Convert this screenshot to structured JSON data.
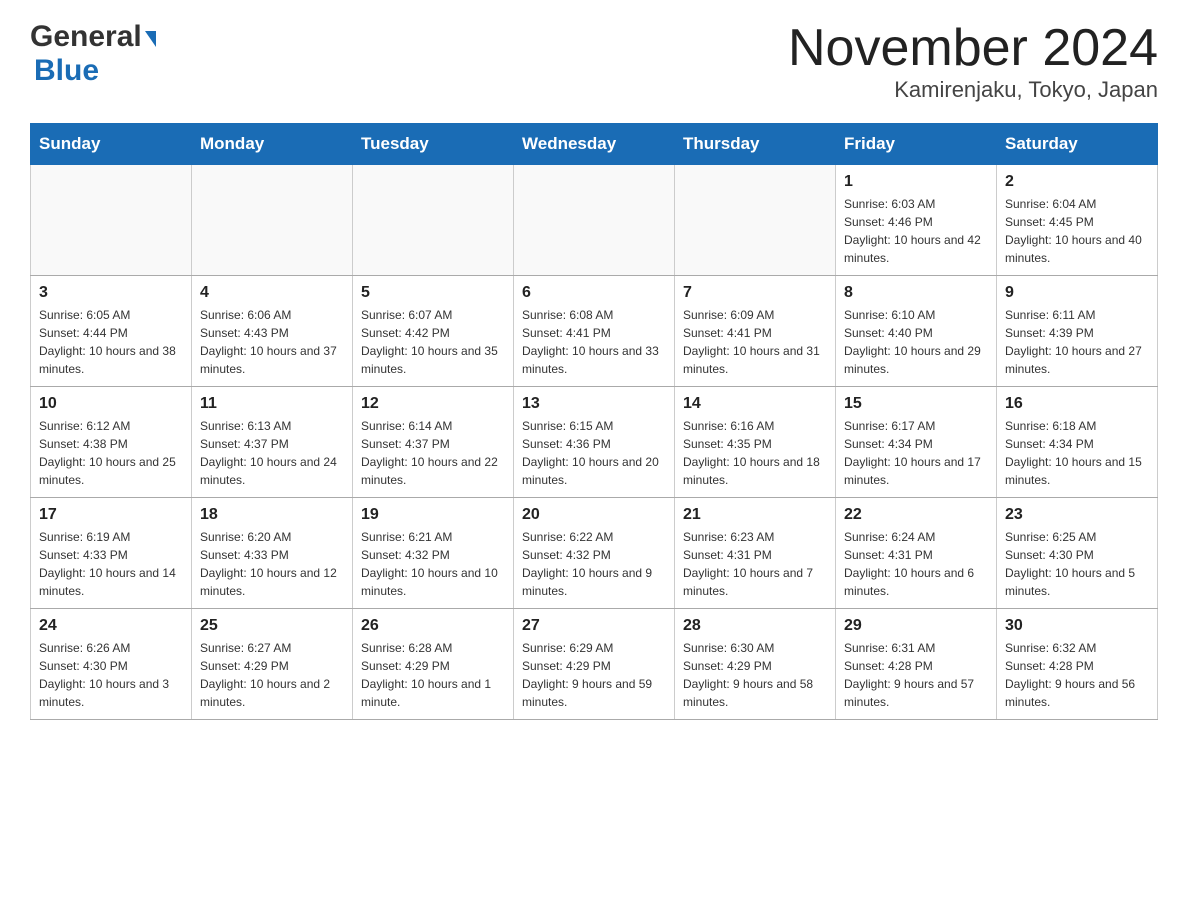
{
  "header": {
    "logo_general": "General",
    "logo_blue": "Blue",
    "month_title": "November 2024",
    "location": "Kamirenjaku, Tokyo, Japan"
  },
  "weekdays": [
    "Sunday",
    "Monday",
    "Tuesday",
    "Wednesday",
    "Thursday",
    "Friday",
    "Saturday"
  ],
  "weeks": [
    [
      {
        "day": "",
        "sunrise": "",
        "sunset": "",
        "daylight": ""
      },
      {
        "day": "",
        "sunrise": "",
        "sunset": "",
        "daylight": ""
      },
      {
        "day": "",
        "sunrise": "",
        "sunset": "",
        "daylight": ""
      },
      {
        "day": "",
        "sunrise": "",
        "sunset": "",
        "daylight": ""
      },
      {
        "day": "",
        "sunrise": "",
        "sunset": "",
        "daylight": ""
      },
      {
        "day": "1",
        "sunrise": "Sunrise: 6:03 AM",
        "sunset": "Sunset: 4:46 PM",
        "daylight": "Daylight: 10 hours and 42 minutes."
      },
      {
        "day": "2",
        "sunrise": "Sunrise: 6:04 AM",
        "sunset": "Sunset: 4:45 PM",
        "daylight": "Daylight: 10 hours and 40 minutes."
      }
    ],
    [
      {
        "day": "3",
        "sunrise": "Sunrise: 6:05 AM",
        "sunset": "Sunset: 4:44 PM",
        "daylight": "Daylight: 10 hours and 38 minutes."
      },
      {
        "day": "4",
        "sunrise": "Sunrise: 6:06 AM",
        "sunset": "Sunset: 4:43 PM",
        "daylight": "Daylight: 10 hours and 37 minutes."
      },
      {
        "day": "5",
        "sunrise": "Sunrise: 6:07 AM",
        "sunset": "Sunset: 4:42 PM",
        "daylight": "Daylight: 10 hours and 35 minutes."
      },
      {
        "day": "6",
        "sunrise": "Sunrise: 6:08 AM",
        "sunset": "Sunset: 4:41 PM",
        "daylight": "Daylight: 10 hours and 33 minutes."
      },
      {
        "day": "7",
        "sunrise": "Sunrise: 6:09 AM",
        "sunset": "Sunset: 4:41 PM",
        "daylight": "Daylight: 10 hours and 31 minutes."
      },
      {
        "day": "8",
        "sunrise": "Sunrise: 6:10 AM",
        "sunset": "Sunset: 4:40 PM",
        "daylight": "Daylight: 10 hours and 29 minutes."
      },
      {
        "day": "9",
        "sunrise": "Sunrise: 6:11 AM",
        "sunset": "Sunset: 4:39 PM",
        "daylight": "Daylight: 10 hours and 27 minutes."
      }
    ],
    [
      {
        "day": "10",
        "sunrise": "Sunrise: 6:12 AM",
        "sunset": "Sunset: 4:38 PM",
        "daylight": "Daylight: 10 hours and 25 minutes."
      },
      {
        "day": "11",
        "sunrise": "Sunrise: 6:13 AM",
        "sunset": "Sunset: 4:37 PM",
        "daylight": "Daylight: 10 hours and 24 minutes."
      },
      {
        "day": "12",
        "sunrise": "Sunrise: 6:14 AM",
        "sunset": "Sunset: 4:37 PM",
        "daylight": "Daylight: 10 hours and 22 minutes."
      },
      {
        "day": "13",
        "sunrise": "Sunrise: 6:15 AM",
        "sunset": "Sunset: 4:36 PM",
        "daylight": "Daylight: 10 hours and 20 minutes."
      },
      {
        "day": "14",
        "sunrise": "Sunrise: 6:16 AM",
        "sunset": "Sunset: 4:35 PM",
        "daylight": "Daylight: 10 hours and 18 minutes."
      },
      {
        "day": "15",
        "sunrise": "Sunrise: 6:17 AM",
        "sunset": "Sunset: 4:34 PM",
        "daylight": "Daylight: 10 hours and 17 minutes."
      },
      {
        "day": "16",
        "sunrise": "Sunrise: 6:18 AM",
        "sunset": "Sunset: 4:34 PM",
        "daylight": "Daylight: 10 hours and 15 minutes."
      }
    ],
    [
      {
        "day": "17",
        "sunrise": "Sunrise: 6:19 AM",
        "sunset": "Sunset: 4:33 PM",
        "daylight": "Daylight: 10 hours and 14 minutes."
      },
      {
        "day": "18",
        "sunrise": "Sunrise: 6:20 AM",
        "sunset": "Sunset: 4:33 PM",
        "daylight": "Daylight: 10 hours and 12 minutes."
      },
      {
        "day": "19",
        "sunrise": "Sunrise: 6:21 AM",
        "sunset": "Sunset: 4:32 PM",
        "daylight": "Daylight: 10 hours and 10 minutes."
      },
      {
        "day": "20",
        "sunrise": "Sunrise: 6:22 AM",
        "sunset": "Sunset: 4:32 PM",
        "daylight": "Daylight: 10 hours and 9 minutes."
      },
      {
        "day": "21",
        "sunrise": "Sunrise: 6:23 AM",
        "sunset": "Sunset: 4:31 PM",
        "daylight": "Daylight: 10 hours and 7 minutes."
      },
      {
        "day": "22",
        "sunrise": "Sunrise: 6:24 AM",
        "sunset": "Sunset: 4:31 PM",
        "daylight": "Daylight: 10 hours and 6 minutes."
      },
      {
        "day": "23",
        "sunrise": "Sunrise: 6:25 AM",
        "sunset": "Sunset: 4:30 PM",
        "daylight": "Daylight: 10 hours and 5 minutes."
      }
    ],
    [
      {
        "day": "24",
        "sunrise": "Sunrise: 6:26 AM",
        "sunset": "Sunset: 4:30 PM",
        "daylight": "Daylight: 10 hours and 3 minutes."
      },
      {
        "day": "25",
        "sunrise": "Sunrise: 6:27 AM",
        "sunset": "Sunset: 4:29 PM",
        "daylight": "Daylight: 10 hours and 2 minutes."
      },
      {
        "day": "26",
        "sunrise": "Sunrise: 6:28 AM",
        "sunset": "Sunset: 4:29 PM",
        "daylight": "Daylight: 10 hours and 1 minute."
      },
      {
        "day": "27",
        "sunrise": "Sunrise: 6:29 AM",
        "sunset": "Sunset: 4:29 PM",
        "daylight": "Daylight: 9 hours and 59 minutes."
      },
      {
        "day": "28",
        "sunrise": "Sunrise: 6:30 AM",
        "sunset": "Sunset: 4:29 PM",
        "daylight": "Daylight: 9 hours and 58 minutes."
      },
      {
        "day": "29",
        "sunrise": "Sunrise: 6:31 AM",
        "sunset": "Sunset: 4:28 PM",
        "daylight": "Daylight: 9 hours and 57 minutes."
      },
      {
        "day": "30",
        "sunrise": "Sunrise: 6:32 AM",
        "sunset": "Sunset: 4:28 PM",
        "daylight": "Daylight: 9 hours and 56 minutes."
      }
    ]
  ]
}
